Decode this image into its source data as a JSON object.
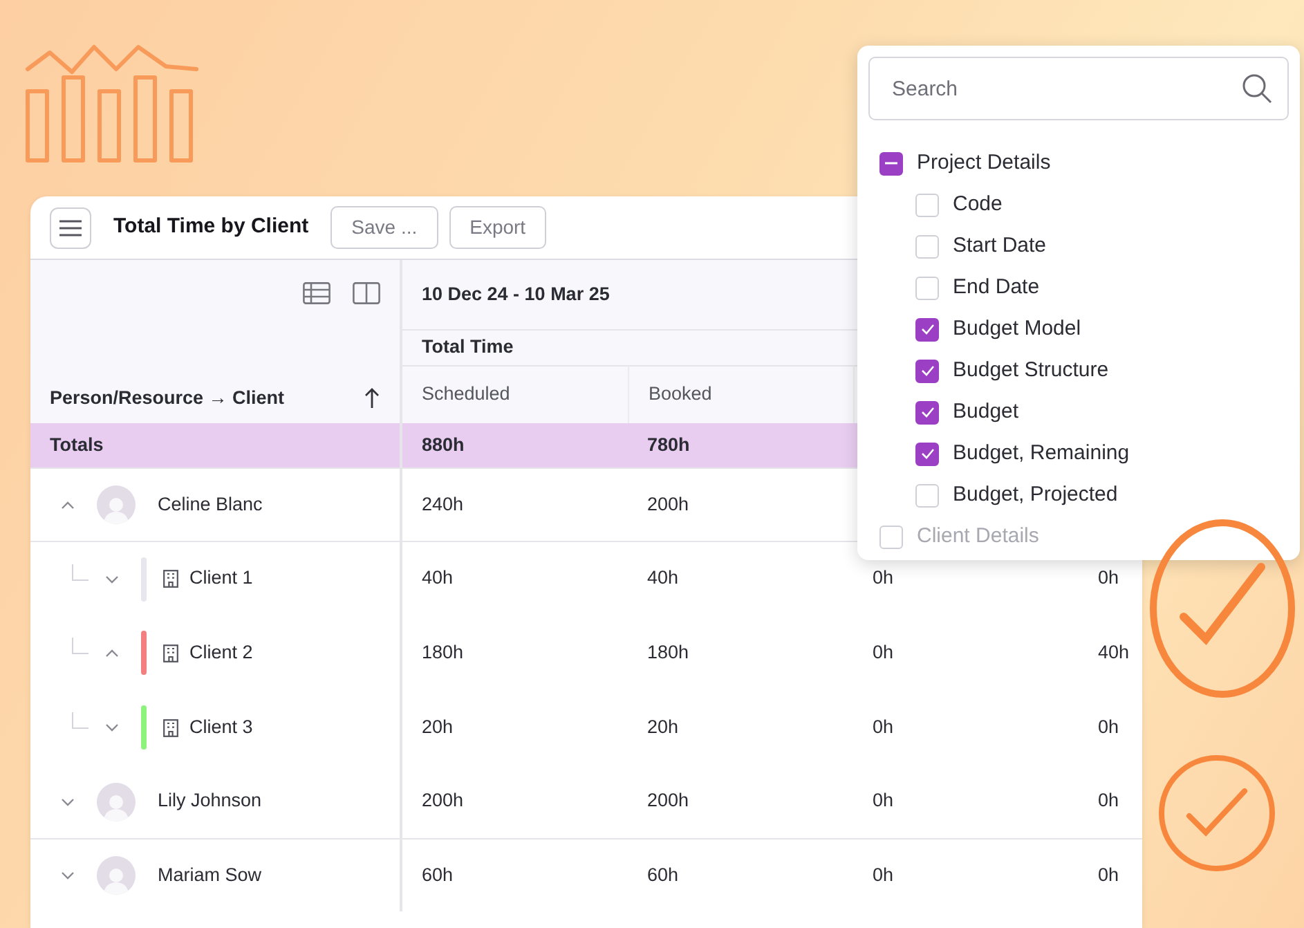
{
  "toolbar": {
    "title": "Total Time by Client",
    "buttons": [
      "Save ...",
      "Export"
    ]
  },
  "table": {
    "row_header": "Person/Resource → Client",
    "period": "10 Dec 24 - 10 Mar 25",
    "group": "Total Time",
    "columns": [
      "Scheduled",
      "Booked"
    ],
    "totals": {
      "label": "Totals",
      "values": [
        "880h",
        "780h"
      ]
    },
    "rows": [
      {
        "name": "Celine Blanc",
        "expanded": true,
        "values": [
          "240h",
          "200h"
        ],
        "children": [
          {
            "name": "Client 1",
            "expanded": false,
            "color": "#e6e6ec",
            "values": [
              "40h",
              "40h",
              "0h",
              "0h"
            ]
          },
          {
            "name": "Client 2",
            "expanded": true,
            "color": "#f47f7f",
            "values": [
              "180h",
              "180h",
              "0h",
              "40h"
            ]
          },
          {
            "name": "Client 3",
            "expanded": false,
            "color": "#8ef27c",
            "values": [
              "20h",
              "20h",
              "0h",
              "0h"
            ]
          }
        ]
      },
      {
        "name": "Lily Johnson",
        "expanded": false,
        "values": [
          "200h",
          "200h",
          "0h",
          "0h"
        ]
      },
      {
        "name": "Mariam Sow",
        "expanded": false,
        "values": [
          "60h",
          "60h",
          "0h",
          "0h"
        ]
      }
    ]
  },
  "column_picker": {
    "placeholder": "Search",
    "groups": [
      {
        "label": "Project Details",
        "indeterminate": true,
        "items": [
          {
            "label": "Code",
            "checked": false
          },
          {
            "label": "Start Date",
            "checked": false
          },
          {
            "label": "End Date",
            "checked": false
          },
          {
            "label": "Budget Model",
            "checked": true
          },
          {
            "label": "Budget Structure",
            "checked": true
          },
          {
            "label": "Budget",
            "checked": true
          },
          {
            "label": "Budget, Remaining",
            "checked": true
          },
          {
            "label": "Budget, Projected",
            "checked": false
          }
        ]
      },
      {
        "label": "Client Details",
        "indeterminate": false
      }
    ]
  }
}
